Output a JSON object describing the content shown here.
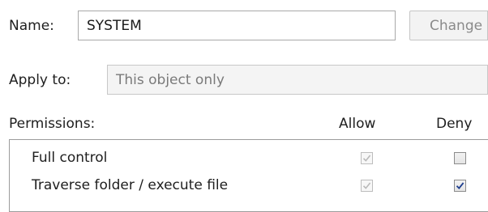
{
  "name": {
    "label": "Name:",
    "value": "SYSTEM",
    "change_label": "Change"
  },
  "apply_to": {
    "label": "Apply to:",
    "value": "This object only"
  },
  "permissions": {
    "label": "Permissions:",
    "allow_header": "Allow",
    "deny_header": "Deny",
    "rows": [
      {
        "label": "Full control",
        "allow": true,
        "allow_enabled": false,
        "deny": false,
        "deny_enabled": true
      },
      {
        "label": "Traverse folder / execute file",
        "allow": true,
        "allow_enabled": false,
        "deny": true,
        "deny_enabled": true
      }
    ]
  },
  "colors": {
    "check_enabled": "#1f3f8f",
    "check_disabled": "#b9b9b9"
  }
}
